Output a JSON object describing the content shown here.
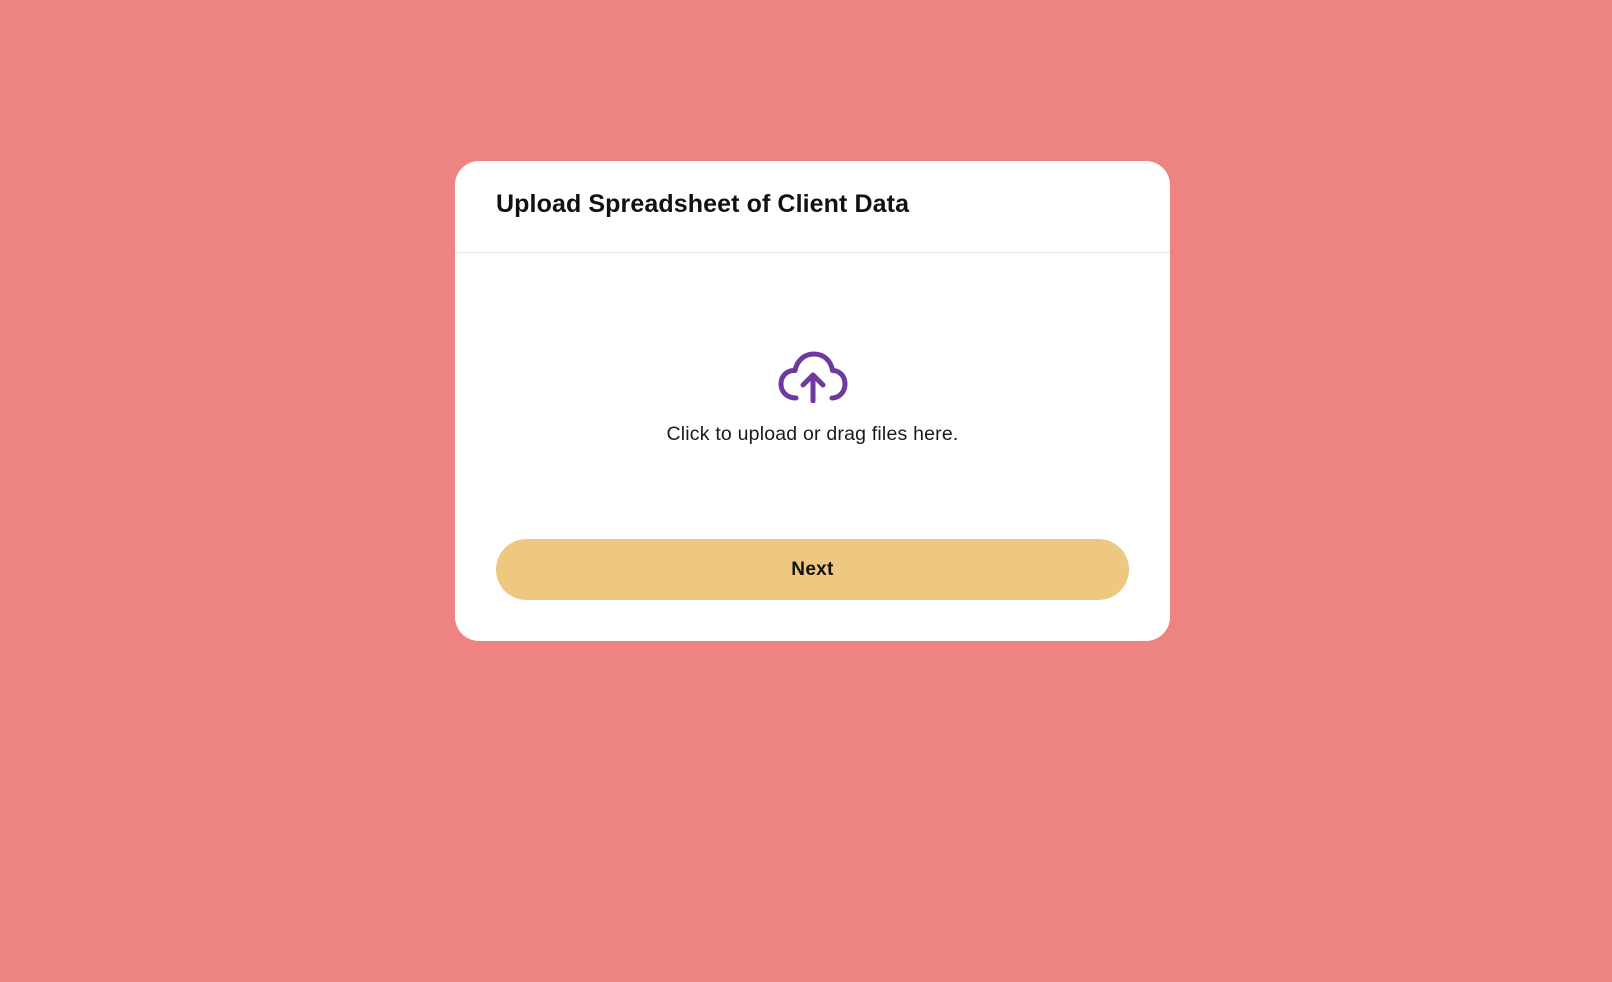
{
  "colors": {
    "background": "#ee8482",
    "card": "#ffffff",
    "accent_icon": "#6e3aa0",
    "button": "#eec780",
    "divider": "#e3e3e3"
  },
  "modal": {
    "title": "Upload Spreadsheet of Client Data",
    "dropzone": {
      "icon": "cloud-upload-icon",
      "text": "Click to upload or drag files here."
    },
    "next_label": "Next"
  }
}
